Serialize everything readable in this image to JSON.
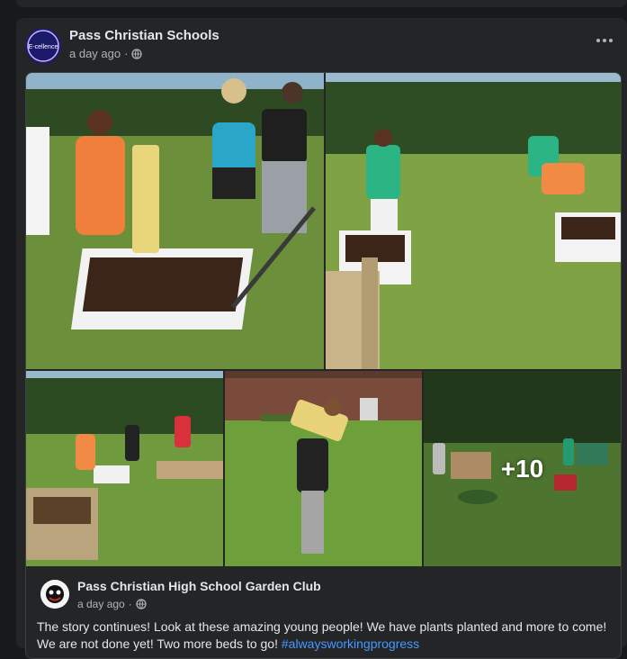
{
  "post": {
    "author": "Pass Christian Schools",
    "time": "a day ago",
    "separator": "·",
    "avatar_text": "E-cellence"
  },
  "shared": {
    "author": "Pass Christian High School Garden Club",
    "time": "a day ago",
    "separator": "·",
    "text": "The story continues! Look at these amazing young people! We have plants planted and more to come! We are not done yet! Two more beds to go! ",
    "hashtag": "#alwaysworkingprogress",
    "more_photos": "+10"
  },
  "icons": {
    "globe": "globe-icon",
    "more": "more-options-icon"
  },
  "colors": {
    "background": "#18191a",
    "card": "#242526",
    "text_primary": "#e4e6eb",
    "text_secondary": "#b0b3b8",
    "link": "#4599ff"
  }
}
